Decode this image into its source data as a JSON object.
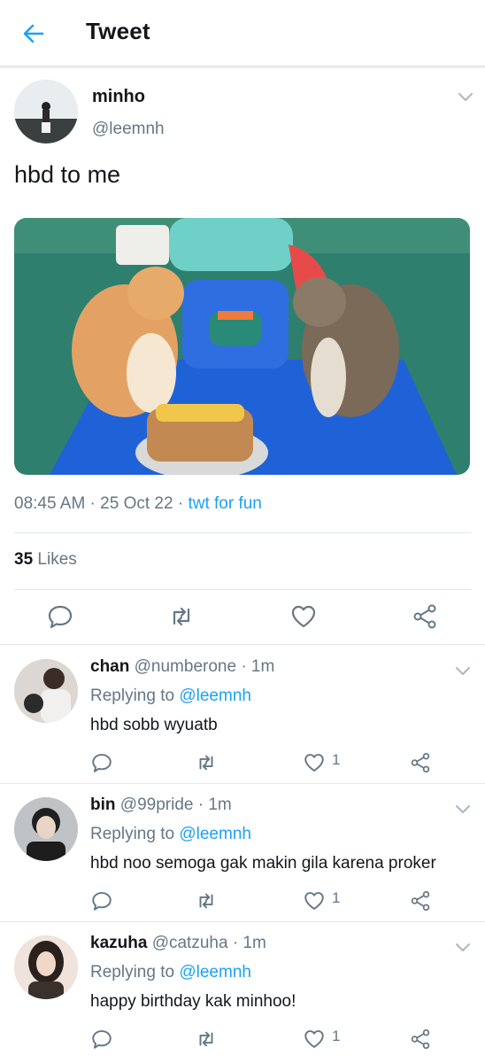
{
  "header": {
    "title": "Tweet"
  },
  "tweet": {
    "name": "minho",
    "handle": "@leemnh",
    "text": "hbd to me",
    "time_date": "08:45 AM · 25 Oct 22 · ",
    "source": "twt for fun",
    "likes_count": "35",
    "likes_label": " Likes"
  },
  "replies": [
    {
      "name": "chan",
      "sub": " @numberone · 1m",
      "replying_prefix": "Replying to ",
      "mention": "@leemnh",
      "text": "hbd sobb wyuatb",
      "like_count": "1"
    },
    {
      "name": "bin",
      "sub": " @99pride · 1m",
      "replying_prefix": "Replying to ",
      "mention": "@leemnh",
      "text": "hbd noo semoga gak makin gila karena proker",
      "like_count": "1"
    },
    {
      "name": "kazuha",
      "sub": " @catzuha · 1m",
      "replying_prefix": "Replying to ",
      "mention": "@leemnh",
      "text": "happy birthday kak minhoo!",
      "like_count": "1"
    }
  ],
  "colors": {
    "accent": "#1da1f2",
    "secondary_text": "#657786",
    "divider": "#e1e8ed"
  },
  "icons": [
    "back-arrow-icon",
    "chevron-down-icon",
    "reply-icon",
    "retweet-icon",
    "heart-icon",
    "share-icon"
  ]
}
